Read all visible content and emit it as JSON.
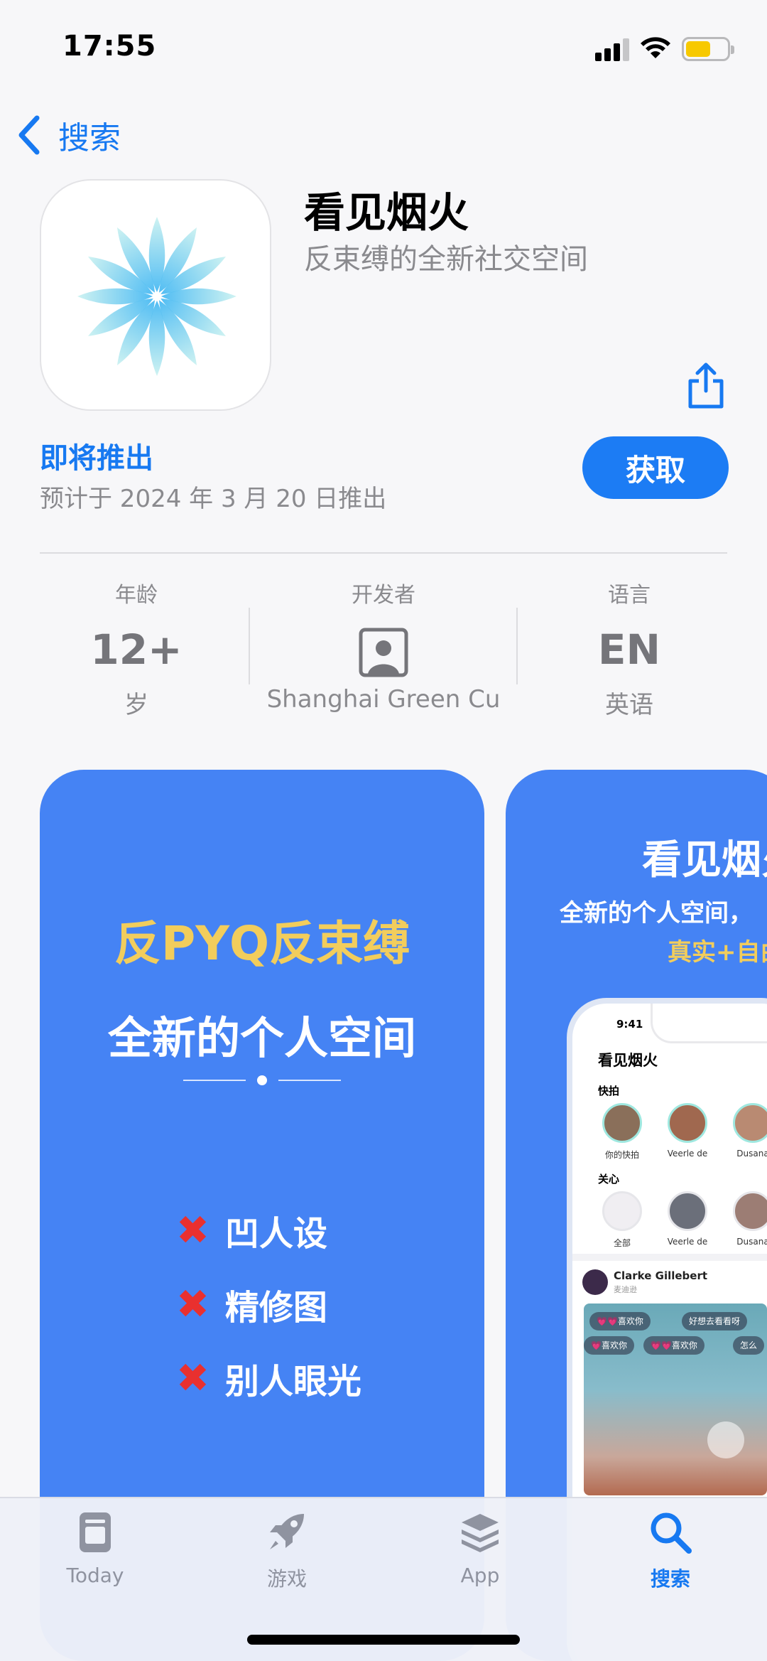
{
  "status": {
    "time": "17:55"
  },
  "nav": {
    "back_label": "搜索"
  },
  "app": {
    "name": "看见烟火",
    "subtitle": "反束缚的全新社交空间",
    "coming_label": "即将推出",
    "release_date": "预计于 2024 年 3 月 20 日推出",
    "get_label": "获取"
  },
  "info": {
    "age": {
      "label": "年龄",
      "value": "12+",
      "sub": "岁"
    },
    "developer": {
      "label": "开发者",
      "sub": "Shanghai Green Cu"
    },
    "language": {
      "label": "语言",
      "value": "EN",
      "sub": "英语"
    }
  },
  "screenshot1": {
    "line1": "反PYQ反束缚",
    "line2": "全新的个人空间",
    "items": [
      "凹人设",
      "精修图",
      "别人眼光"
    ]
  },
  "screenshot2": {
    "title": "看见烟火",
    "subtitle": "全新的个人空间，",
    "tagline": "真实+自由",
    "phone": {
      "time": "9:41",
      "app_title": "看见烟火",
      "section_quick": "快拍",
      "section_follow": "关心",
      "quick_names": [
        "你的快拍",
        "Veerle de",
        "Dusana"
      ],
      "follow_names": [
        "全部",
        "Veerle de",
        "Dusana"
      ],
      "post_name": "Clarke Gillebert",
      "post_meta": "麦迪逊",
      "chips": [
        "💗💗喜欢你",
        "好想去看看呀",
        "💗喜欢你",
        "💗💗喜欢你",
        "怎么"
      ]
    }
  },
  "tabs": [
    {
      "label": "Today",
      "icon": "today-icon"
    },
    {
      "label": "游戏",
      "icon": "rocket-icon"
    },
    {
      "label": "App",
      "icon": "layers-icon"
    },
    {
      "label": "搜索",
      "icon": "search-icon"
    }
  ],
  "colors": {
    "accent": "#1779f1",
    "screenshot_bg": "#4583f4",
    "highlight": "#f2cd5c"
  }
}
